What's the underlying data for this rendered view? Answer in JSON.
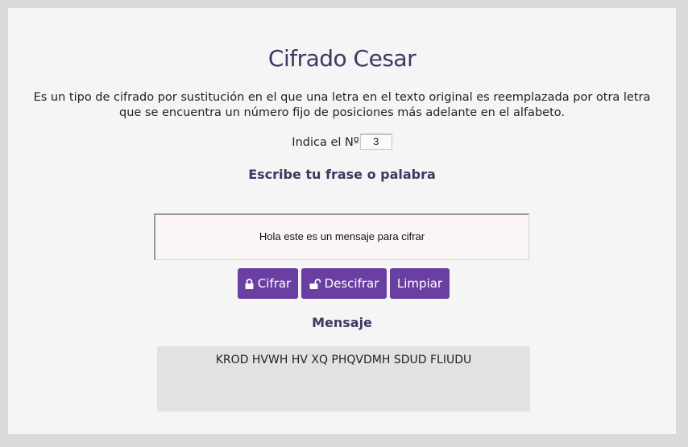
{
  "page": {
    "title": "Cifrado Cesar",
    "description": "Es un tipo de cifrado por sustitución en el que una letra en el texto original es reemplazada por otra letra que se encuentra un número fijo de posiciones más adelante en el alfabeto."
  },
  "shift": {
    "label": "Indica el Nº",
    "value": "3"
  },
  "input_section": {
    "heading": "Escribe tu frase o palabra",
    "phrase": "Hola este es un mensaje para cifrar"
  },
  "buttons": {
    "cipher": {
      "label": "Cifrar",
      "icon": "lock-icon"
    },
    "decipher": {
      "label": "Descifrar",
      "icon": "unlock-icon"
    },
    "clear": {
      "label": "Limpiar"
    }
  },
  "output_section": {
    "heading": "Mensaje",
    "message": "KROD HVWH HV XQ PHQVDMH SDUD FLIUDU"
  },
  "colors": {
    "accent": "#6a3fa2",
    "heading": "#433562",
    "background": "#f5f5f5",
    "frame": "#dcdad9",
    "output_bg": "#e4e2e1"
  }
}
